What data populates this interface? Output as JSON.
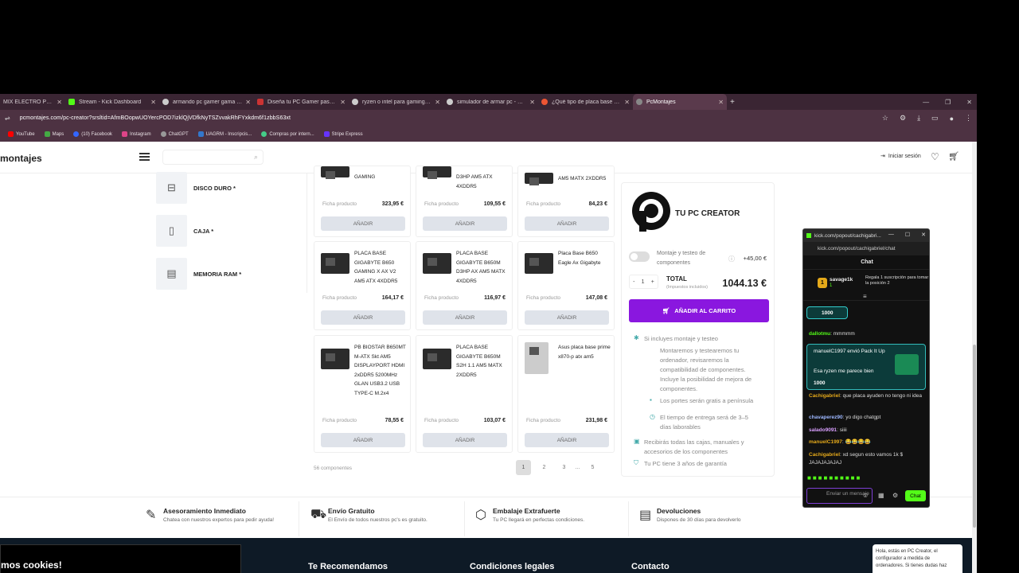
{
  "browser": {
    "tabs": [
      {
        "label": "MIX ELECTRO POP (D",
        "color": "#e33"
      },
      {
        "label": "Stream - Kick Dashboard",
        "color": "#53fc18"
      },
      {
        "label": "armando pc gamer gama alta",
        "color": "#ccc"
      },
      {
        "label": "Diseña tu PC Gamer paso a pa",
        "color": "#c33"
      },
      {
        "label": "ryzen o intel para gaming - Bus",
        "color": "#ccc"
      },
      {
        "label": "simulador de armar pc - Buscar",
        "color": "#ccc"
      },
      {
        "label": "¿Qué tipo de placa base para e",
        "color": "#e53"
      },
      {
        "label": "PcMontajes",
        "color": "#888"
      }
    ],
    "url": "pcmontajes.com/pc-creator?srsltid=AfmBOopwUOYercPOD7izklQjVDfkNyTSZvvakRhFYxkdm6f1zbbS63xt",
    "bookmarks": [
      {
        "label": "YouTube",
        "color": "#f00"
      },
      {
        "label": "Maps",
        "color": "#4a4"
      },
      {
        "label": "(10) Facebook",
        "color": "#36f"
      },
      {
        "label": "Instagram",
        "color": "#d48"
      },
      {
        "label": "ChatGPT",
        "color": "#999"
      },
      {
        "label": "UAGRM - Inscripcis...",
        "color": "#37c"
      },
      {
        "label": "Compras por intern...",
        "color": "#4c8"
      },
      {
        "label": "Stripe Express",
        "color": "#63f"
      }
    ]
  },
  "site": {
    "logo": "montajes",
    "login": "Iniciar sesión"
  },
  "categories": [
    "DISCO DURO *",
    "CAJA *",
    "MEMORIA RAM *"
  ],
  "products": [
    {
      "name": "GAMING",
      "ficha": "Ficha producto",
      "price": "323,95 €",
      "add": "AÑADIR"
    },
    {
      "name": "D3HP AM5 ATX 4XDDR5",
      "ficha": "Ficha producto",
      "price": "109,55 €",
      "add": "AÑADIR"
    },
    {
      "name": "AM5 MATX 2XDDR5",
      "ficha": "Ficha producto",
      "price": "84,23 €",
      "add": "AÑADIR"
    },
    {
      "name": "PLACA BASE GIGABYTE B650 GAMING X AX V2 AM5 ATX 4XDDR5",
      "ficha": "Ficha producto",
      "price": "164,17 €",
      "add": "AÑADIR"
    },
    {
      "name": "PLACA BASE GIGABYTE B650M D3HP AX AM5 MATX 4XDDR5",
      "ficha": "Ficha producto",
      "price": "116,97 €",
      "add": "AÑADIR"
    },
    {
      "name": "Placa Base B650 Eagle Ax Gigabyte",
      "ficha": "Ficha producto",
      "price": "147,08 €",
      "add": "AÑADIR"
    },
    {
      "name": "PB BIOSTAR B650MT M-ATX Skt AM5 DISPLAYPORT HDMI 2xDDR5 5200MHz GLAN USB3.2 USB TYPE-C M.2x4",
      "ficha": "Ficha producto",
      "price": "78,55 €",
      "add": "AÑADIR"
    },
    {
      "name": "PLACA BASE GIGABYTE B650M S2H 1.1 AM5 MATX 2XDDR5",
      "ficha": "Ficha producto",
      "price": "103,07 €",
      "add": "AÑADIR"
    },
    {
      "name": "Asus placa base prime x870-p atx am5",
      "ficha": "Ficha producto",
      "price": "231,98 €",
      "add": "AÑADIR"
    }
  ],
  "pagination": {
    "count_label": "56 componentes",
    "pages": [
      "1",
      "2",
      "3",
      "...",
      "5"
    ],
    "current": "1"
  },
  "creator": {
    "title": "TU PC CREATOR",
    "montaje_label": "Montaje y testeo de componentes",
    "montaje_price": "+45,00 €",
    "qty": "1",
    "total_label": "TOTAL",
    "tax_label": "(Impuestos incluidos)",
    "total": "1044.13 €",
    "add_cart": "AÑADIR AL CARRITO",
    "feat1": "Si incluyes montaje y testeo",
    "feat1_sub": "Montaremos y testearemos tu ordenador, revisaremos la compatibilidad de componentes. Incluye la posibilidad de mejora de componentes.",
    "feat2": "Los portes serán gratis a península",
    "feat3": "El tiempo de entrega será de 3–5 días laborables",
    "feat4": "Recibirás todas las cajas, manuales y accesorios de los componentes",
    "feat5": "Tu PC tiene 3 años de garantía"
  },
  "features": [
    {
      "title": "Asesoramiento Inmediato",
      "desc": "Chatea con nuestros expertos para pedir ayuda!"
    },
    {
      "title": "Envío Gratuito",
      "desc": "El Envío de todos nuestros pc's es gratuito."
    },
    {
      "title": "Embalaje Extrafuerte",
      "desc": "Tu PC llegará en perfectas condiciones."
    },
    {
      "title": "Devoluciones",
      "desc": "Dispones de 30 días para devolverlo"
    }
  ],
  "footer": {
    "cookies": "mos cookies!",
    "col1": "Te Recomendamos",
    "col2": "Condiciones legales",
    "col3": "Contacto",
    "assistant": "Hola, estás en PC Creator, el configurador a medida de ordenadores. Si tienes dudas haz"
  },
  "chat": {
    "window_title": "kick.com/popout/cachigabri...",
    "url": "kick.com/popout/cachigabriel/chat",
    "header": "Chat",
    "top_user": "savage1k",
    "top_count": "1",
    "top_msg": "Regala 1 suscripción para tomar la posición 2",
    "pill": "1000",
    "messages": [
      {
        "user": "dallotmu",
        "text": "mmmmm",
        "color": "#53fc18"
      },
      {
        "user": "Cachigabriel",
        "text": "que placa ayuden no tengo ni idea",
        "color": "#e5a91a"
      },
      {
        "user": "chavaperez90",
        "text": "yo digo chatgpt",
        "color": "#9db7ff"
      },
      {
        "user": "salado9091",
        "text": "siiii",
        "color": "#d99fff"
      },
      {
        "user": "manuelC1997",
        "text": "😂😂😂😂",
        "color": "#e5a91a"
      },
      {
        "user": "Cachigabriel",
        "text": "xd segun esto vamos 1k $ JAJAJAJAJAJ",
        "color": "#e5a91a"
      }
    ],
    "kick_title": "manuelC1997 envió Pack It Up",
    "kick_msg": "Esa ryzen me parece bien",
    "kick_value": "1000",
    "input_placeholder": "Enviar un mensaje",
    "send": "Chat"
  }
}
